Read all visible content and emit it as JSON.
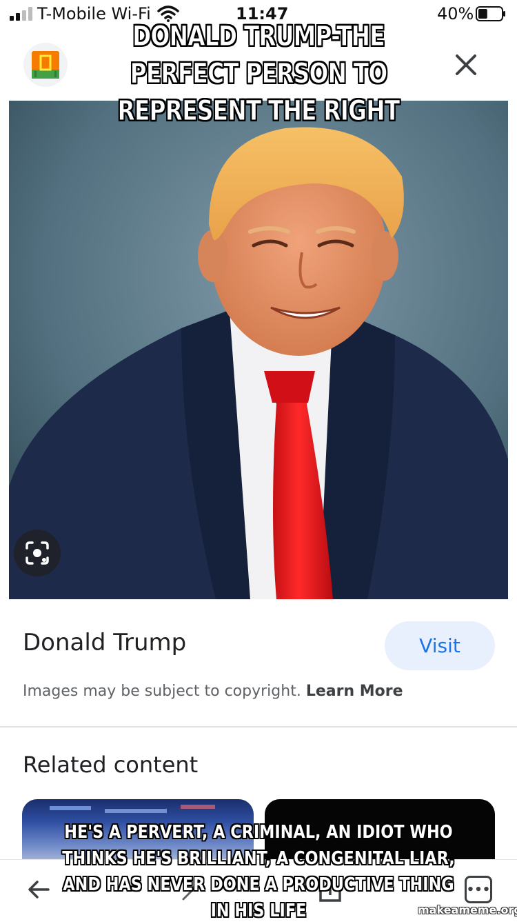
{
  "status_bar": {
    "carrier": "T-Mobile Wi-Fi",
    "time": "11:47",
    "battery_percent": "40%",
    "battery_level": 0.4
  },
  "header": {
    "site_icon": "site-favicon-icon",
    "close_icon": "close-icon"
  },
  "meme": {
    "top_text": "DONALD TRUMP-THE PERFECT PERSON TO REPRESENT THE RIGHT",
    "bottom_text": "HE'S A PERVERT, A CRIMINAL, AN IDIOT WHO THINKS HE'S BRILLIANT, A CONGENITAL LIAR, AND HAS NEVER DONE A PRODUCTIVE THING IN HIS LIFE",
    "watermark": "makeameme.org"
  },
  "image_viewer": {
    "lens_icon": "google-lens-icon"
  },
  "result": {
    "title": "Donald Trump",
    "visit_label": "Visit",
    "copyright_text": "Images may be subject to copyright.",
    "learn_more_label": "Learn More"
  },
  "related": {
    "heading": "Related content"
  },
  "bottom_nav": {
    "back_icon": "back-arrow-icon",
    "more_icon": "more-options-icon"
  },
  "colors": {
    "accent": "#1a73e8",
    "visit_bg": "#e8f0fe",
    "tie_red": "#e3141b",
    "suit_navy": "#1d2a4a"
  }
}
